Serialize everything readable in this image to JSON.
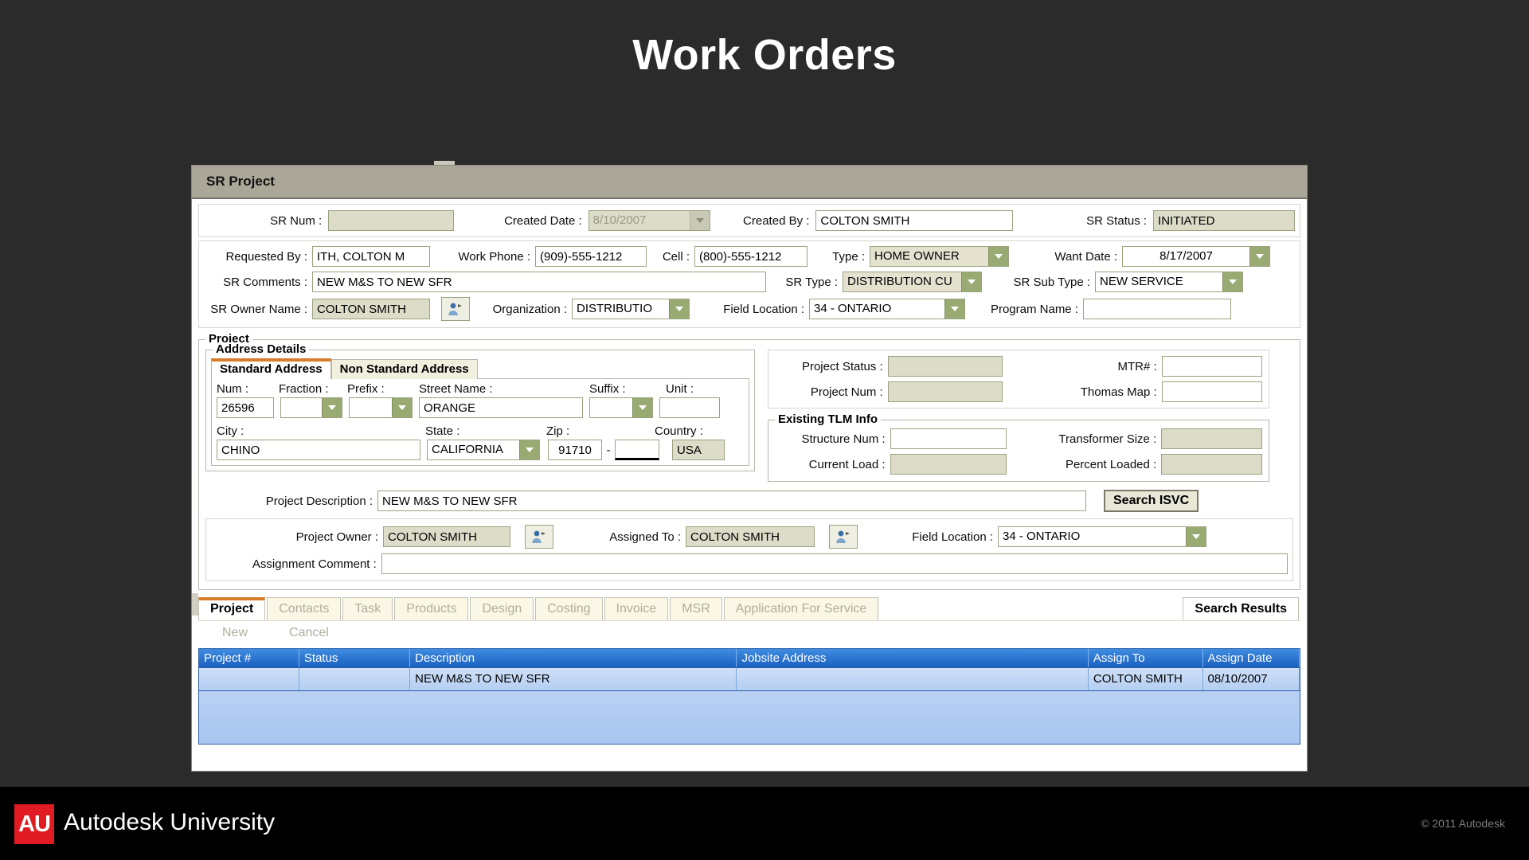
{
  "slide": {
    "title": "Work Orders",
    "footer": {
      "logo_mark": "AU",
      "logo_text": "Autodesk University",
      "copyright": "© 2011 Autodesk"
    }
  },
  "window": {
    "title": "SR Project"
  },
  "sr_header": {
    "sr_num_label": "SR Num :",
    "sr_num_value": "",
    "created_date_label": "Created Date :",
    "created_date_value": "8/10/2007",
    "created_by_label": "Created By :",
    "created_by_value": "COLTON SMITH",
    "sr_status_label": "SR Status :",
    "sr_status_value": "INITIATED"
  },
  "sr_detail": {
    "requested_by_label": "Requested By :",
    "requested_by_value": "ITH, COLTON M",
    "work_phone_label": "Work Phone :",
    "work_phone_value": "(909)-555-1212",
    "cell_label": "Cell :",
    "cell_value": "(800)-555-1212",
    "type_label": "Type :",
    "type_value": "HOME OWNER",
    "want_date_label": "Want Date :",
    "want_date_value": "8/17/2007",
    "sr_comments_label": "SR Comments :",
    "sr_comments_value": "NEW M&S TO NEW SFR",
    "sr_type_label": "SR Type :",
    "sr_type_value": "DISTRIBUTION CU",
    "sr_sub_type_label": "SR Sub Type :",
    "sr_sub_type_value": "NEW SERVICE",
    "sr_owner_name_label": "SR Owner Name :",
    "sr_owner_name_value": "COLTON SMITH",
    "organization_label": "Organization :",
    "organization_value": "DISTRIBUTIO",
    "field_location_label": "Field Location :",
    "field_location_value": "34 - ONTARIO",
    "program_name_label": "Program Name :",
    "program_name_value": ""
  },
  "project_group": {
    "caption": "Project",
    "address_details": {
      "caption": "Address Details",
      "tabs": [
        {
          "label": "Standard Address",
          "active": true
        },
        {
          "label": "Non Standard Address",
          "active": false
        }
      ],
      "num_label": "Num :",
      "num_value": "26596",
      "fraction_label": "Fraction :",
      "fraction_value": "",
      "prefix_label": "Prefix :",
      "prefix_value": "",
      "street_name_label": "Street Name :",
      "street_name_value": "ORANGE",
      "suffix_label": "Suffix :",
      "suffix_value": "",
      "unit_label": "Unit :",
      "unit_value": "",
      "city_label": "City :",
      "city_value": "CHINO",
      "state_label": "State :",
      "state_value": "CALIFORNIA",
      "zip_label": "Zip :",
      "zip_value": "91710",
      "zip_ext_value": "",
      "zip_separator": "-",
      "country_label": "Country :",
      "country_value": "USA"
    },
    "project_info": {
      "project_status_label": "Project Status :",
      "project_status_value": "",
      "mtr_label": "MTR# :",
      "mtr_value": "",
      "project_num_label": "Project Num :",
      "project_num_value": "",
      "thomas_map_label": "Thomas Map :",
      "thomas_map_value": ""
    },
    "existing_tlm": {
      "caption": "Existing TLM Info",
      "structure_num_label": "Structure Num :",
      "structure_num_value": "",
      "transformer_size_label": "Transformer Size :",
      "transformer_size_value": "",
      "current_load_label": "Current Load :",
      "current_load_value": "",
      "percent_loaded_label": "Percent Loaded :",
      "percent_loaded_value": ""
    },
    "project_description_label": "Project Description :",
    "project_description_value": "NEW M&S TO NEW SFR",
    "search_isvc_label": "Search ISVC",
    "assignment": {
      "project_owner_label": "Project Owner :",
      "project_owner_value": "COLTON SMITH",
      "assigned_to_label": "Assigned To :",
      "assigned_to_value": "COLTON SMITH",
      "field_location_label": "Field Location :",
      "field_location_value": "34 - ONTARIO",
      "assignment_comment_label": "Assignment Comment :",
      "assignment_comment_value": ""
    }
  },
  "main_tabs": [
    {
      "label": "Project",
      "state": "active"
    },
    {
      "label": "Contacts",
      "state": "normal"
    },
    {
      "label": "Task",
      "state": "normal"
    },
    {
      "label": "Products",
      "state": "normal"
    },
    {
      "label": "Design",
      "state": "normal"
    },
    {
      "label": "Costing",
      "state": "normal"
    },
    {
      "label": "Invoice",
      "state": "normal"
    },
    {
      "label": "MSR",
      "state": "normal"
    },
    {
      "label": "Application For Service",
      "state": "normal"
    },
    {
      "label": "Search Results",
      "state": "selected"
    }
  ],
  "command_bar": {
    "new_label": "New",
    "cancel_label": "Cancel"
  },
  "results_grid": {
    "columns": [
      "Project #",
      "Status",
      "Description",
      "Jobsite Address",
      "Assign To",
      "Assign Date"
    ],
    "rows": [
      {
        "project_num": "",
        "status": "",
        "description": "NEW M&S TO NEW SFR",
        "jobsite_address": "",
        "assign_to": "COLTON SMITH",
        "assign_date": "08/10/2007"
      }
    ]
  },
  "colors": {
    "slide_background": "#2b2b2b",
    "titlebar": "#aaa698",
    "field_border": "#9aa37f",
    "combo_button": "#9aaa73",
    "readonly_field": "#dcdcc8",
    "active_tab_accent": "#d87d2a",
    "grid_header": "#2a6fd0",
    "au_red": "#e01b22"
  }
}
